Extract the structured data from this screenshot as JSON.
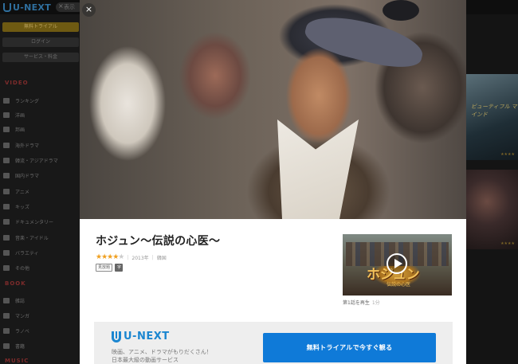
{
  "background": {
    "logo_text": "U-NEXT",
    "search_placeholder": "表示",
    "sidebar": {
      "buttons": [
        "無料トライアル",
        "ログイン",
        "サービス・料金"
      ],
      "sections": [
        "VIDEO",
        "BOOK",
        "MUSIC"
      ],
      "video_items": [
        "ランキング",
        "洋画",
        "邦画",
        "海外ドラマ",
        "韓流・アジアドラマ",
        "国内ドラマ",
        "アニメ",
        "キッズ",
        "ドキュメンタリー",
        "音楽・アイドル",
        "バラエティ",
        "その他"
      ],
      "book_items": [
        "雑誌",
        "マンガ",
        "ラノベ",
        "書籍"
      ]
    },
    "right_panel": {
      "card1_title": "ビューティフル マインド",
      "card1_stars": "★★★★",
      "card2_stars": "★★★★"
    }
  },
  "modal": {
    "close_label": "×",
    "title": "ホジュン～伝説の心医～",
    "rating": {
      "stars_on": "★★★★",
      "stars_off": "★",
      "value": 4
    },
    "year": "2013年",
    "country": "韓国",
    "badges": [
      "見放題",
      "字"
    ],
    "thumbnail": {
      "logo_text": "ホジュン",
      "subtitle": "伝説の心医"
    },
    "episode": {
      "label": "第1話を再生",
      "duration": "1分"
    },
    "promo": {
      "logo_text": "U-NEXT",
      "text_line1": "映画、アニメ、ドラマがもりだくさん！",
      "text_line2": "日本最大級の動画サービス",
      "cta_label": "無料トライアルで今すぐ観る"
    }
  },
  "colors": {
    "accent": "#0f7ad8",
    "brand": "#1b86d0",
    "star": "#f0a020",
    "trial_button": "#6e5a12"
  }
}
